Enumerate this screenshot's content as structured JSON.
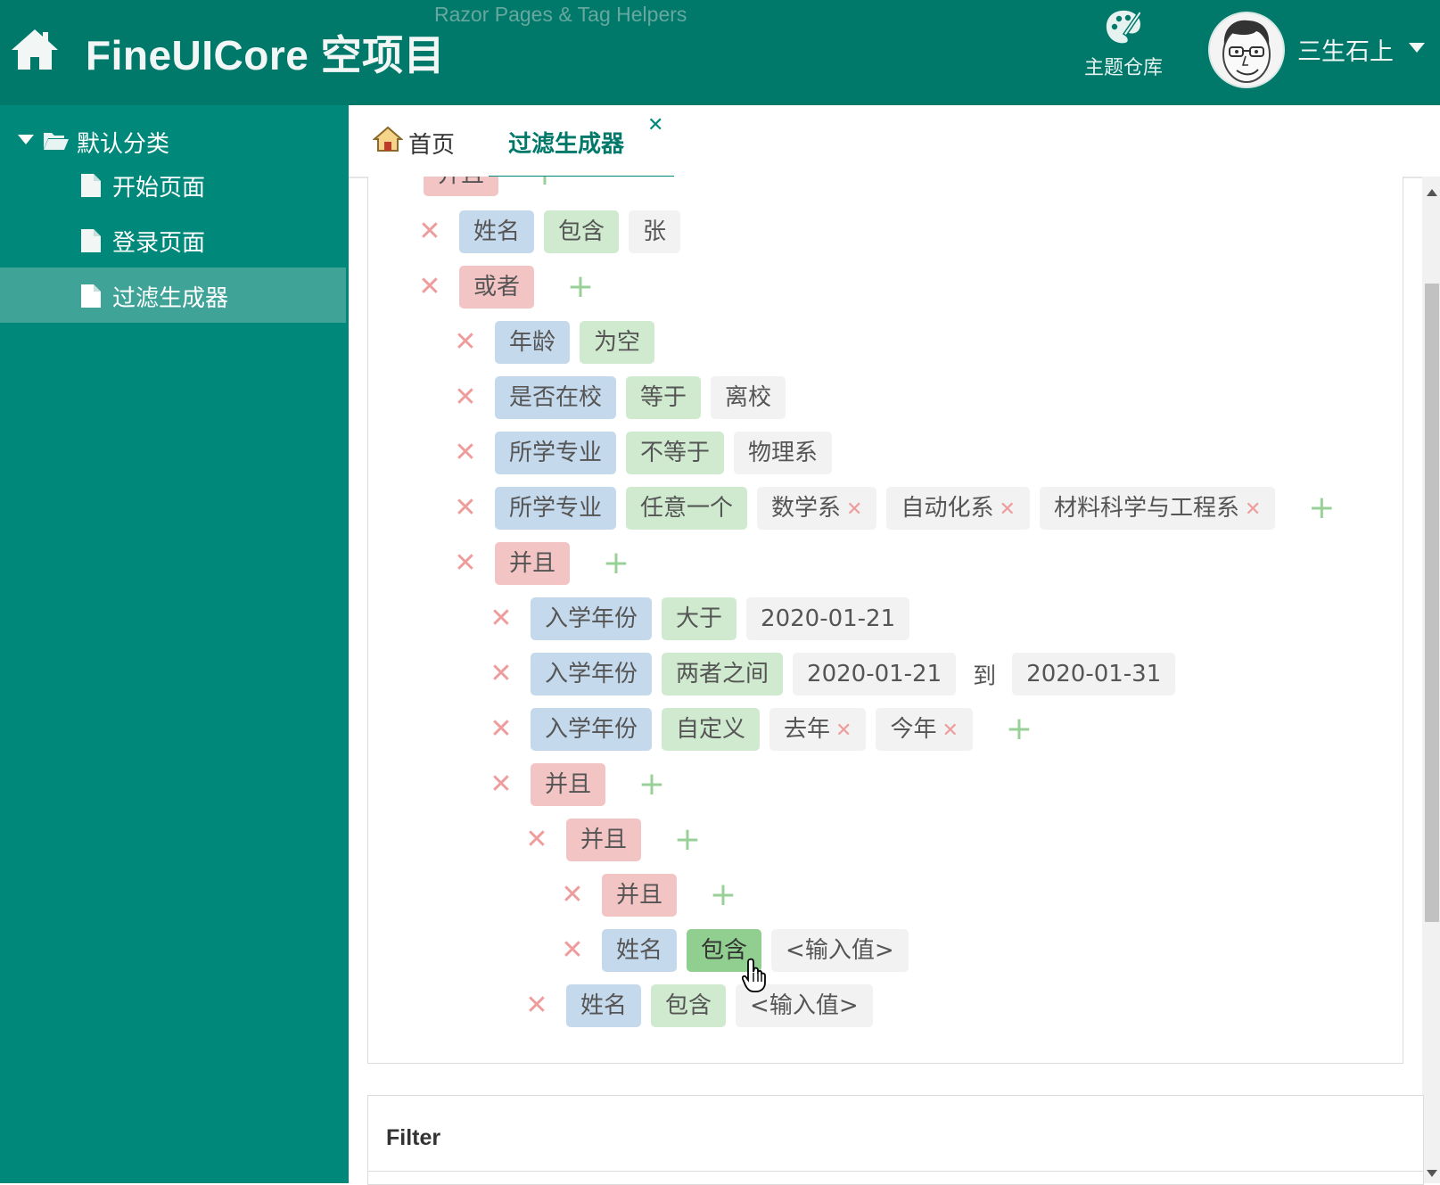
{
  "header": {
    "title": "FineUICore 空项目",
    "subtitle": "Razor Pages & Tag Helpers",
    "theme_label": "主题仓库",
    "user_name": "三生石上"
  },
  "sidebar": {
    "group_label": "默认分类",
    "items": [
      {
        "label": "开始页面",
        "active": false
      },
      {
        "label": "登录页面",
        "active": false
      },
      {
        "label": "过滤生成器",
        "active": true
      }
    ]
  },
  "tabs": [
    {
      "label": "首页",
      "icon": "home-icon"
    },
    {
      "label": "过滤生成器",
      "closable": true
    }
  ],
  "filter": {
    "top_logic": "并且",
    "r1": {
      "field": "姓名",
      "op": "包含",
      "value": "张"
    },
    "r2": {
      "logic": "或者"
    },
    "r3": {
      "field": "年龄",
      "op": "为空"
    },
    "r4": {
      "field": "是否在校",
      "op": "等于",
      "value": "离校"
    },
    "r5": {
      "field": "所学专业",
      "op": "不等于",
      "value": "物理系"
    },
    "r6": {
      "field": "所学专业",
      "op": "任意一个",
      "tags": [
        "数学系",
        "自动化系",
        "材料科学与工程系"
      ]
    },
    "r7": {
      "logic": "并且"
    },
    "r8": {
      "field": "入学年份",
      "op": "大于",
      "value": "2020-01-21"
    },
    "r9": {
      "field": "入学年份",
      "op": "两者之间",
      "value": "2020-01-21",
      "sep": "到",
      "value2": "2020-01-31"
    },
    "r10": {
      "field": "入学年份",
      "op": "自定义",
      "tags": [
        "去年",
        "今年"
      ]
    },
    "r11": {
      "logic": "并且"
    },
    "r12": {
      "logic": "并且"
    },
    "r13": {
      "logic": "并且"
    },
    "r14": {
      "field": "姓名",
      "op": "包含",
      "placeholder": "<输入值>"
    },
    "r15": {
      "field": "姓名",
      "op": "包含",
      "placeholder": "<输入值>"
    }
  },
  "output": {
    "title": "Filter"
  },
  "colors": {
    "header": "#00796b",
    "sidebar": "#00897b",
    "sidebar_active": "#40a398",
    "field_chip": "#c5d9ed",
    "op_chip": "#cfeacf",
    "value_chip": "#f2f2f2",
    "logic_chip": "#f3c4c4",
    "remove": "#ee9c9c",
    "add": "#98d098"
  }
}
